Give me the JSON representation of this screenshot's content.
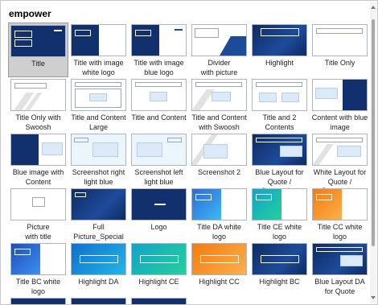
{
  "header": {
    "title": "empower"
  },
  "layouts": [
    {
      "label": "Title",
      "selected": true
    },
    {
      "label": "Title with image\nwhite logo"
    },
    {
      "label": "Title with image\nblue logo"
    },
    {
      "label": "Divider\nwith picture"
    },
    {
      "label": "Highlight"
    },
    {
      "label": "Title Only"
    },
    {
      "label": "Title Only with\nSwoosh"
    },
    {
      "label": "Title and Content\nLarge"
    },
    {
      "label": "Title and Content"
    },
    {
      "label": "Title and Content\nwith Swoosh"
    },
    {
      "label": "Title and 2\nContents"
    },
    {
      "label": "Content with blue\nimage"
    },
    {
      "label": "Blue image with\nContent"
    },
    {
      "label": "Screenshot right\nlight blue"
    },
    {
      "label": "Screenshot left\nlight blue"
    },
    {
      "label": "Screenshot 2"
    },
    {
      "label": "Blue Layout for\nQuote / Screensh..."
    },
    {
      "label": "White Layout for\nQuote / Screensh..."
    },
    {
      "label": "Picture\nwith title"
    },
    {
      "label": "Full\nPicture_Special"
    },
    {
      "label": "Logo"
    },
    {
      "label": "Title DA white\nlogo"
    },
    {
      "label": "Title CE white\nlogo"
    },
    {
      "label": "Title CC white\nlogo"
    },
    {
      "label": "Title BC white\nlogo"
    },
    {
      "label": "Highlight DA"
    },
    {
      "label": "Highlight CE"
    },
    {
      "label": "Highlight CC"
    },
    {
      "label": "Highlight BC"
    },
    {
      "label": "Blue Layout DA\nfor Quote"
    }
  ]
}
